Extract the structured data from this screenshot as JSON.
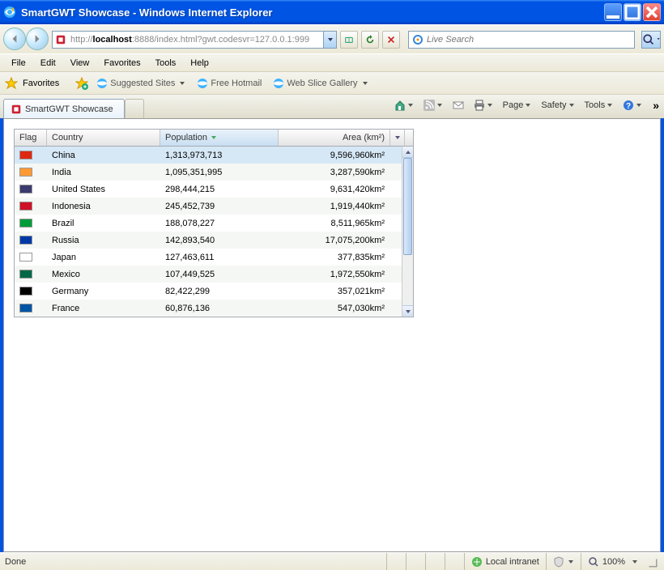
{
  "window": {
    "title": "SmartGWT Showcase - Windows Internet Explorer"
  },
  "address": {
    "prefix": "http://",
    "host": "localhost",
    "rest": ":8888/index.html?gwt.codesvr=127.0.0.1:999",
    "search_placeholder": "Live Search"
  },
  "menus": [
    "File",
    "Edit",
    "View",
    "Favorites",
    "Tools",
    "Help"
  ],
  "favbar": {
    "label": "Favorites",
    "links": [
      "Suggested Sites",
      "Free Hotmail",
      "Web Slice Gallery"
    ]
  },
  "tab": {
    "title": "SmartGWT Showcase"
  },
  "cmdbar": [
    "Page",
    "Safety",
    "Tools"
  ],
  "grid": {
    "columns": {
      "flag": "Flag",
      "country": "Country",
      "population": "Population",
      "area": "Area (km²)"
    },
    "rows": [
      {
        "country": "China",
        "population": "1,313,973,713",
        "area": "9,596,960km²",
        "flag": "#de2910",
        "selected": true
      },
      {
        "country": "India",
        "population": "1,095,351,995",
        "area": "3,287,590km²",
        "flag": "#ff9933"
      },
      {
        "country": "United States",
        "population": "298,444,215",
        "area": "9,631,420km²",
        "flag": "#3c3b6e"
      },
      {
        "country": "Indonesia",
        "population": "245,452,739",
        "area": "1,919,440km²",
        "flag": "#ce1126"
      },
      {
        "country": "Brazil",
        "population": "188,078,227",
        "area": "8,511,965km²",
        "flag": "#009b3a"
      },
      {
        "country": "Russia",
        "population": "142,893,540",
        "area": "17,075,200km²",
        "flag": "#0039a6"
      },
      {
        "country": "Japan",
        "population": "127,463,611",
        "area": "377,835km²",
        "flag": "#ffffff"
      },
      {
        "country": "Mexico",
        "population": "107,449,525",
        "area": "1,972,550km²",
        "flag": "#006847"
      },
      {
        "country": "Germany",
        "population": "82,422,299",
        "area": "357,021km²",
        "flag": "#000000"
      },
      {
        "country": "France",
        "population": "60,876,136",
        "area": "547,030km²",
        "flag": "#0055a4"
      }
    ]
  },
  "status": {
    "left": "Done",
    "zone": "Local intranet",
    "zoom": "100%"
  }
}
